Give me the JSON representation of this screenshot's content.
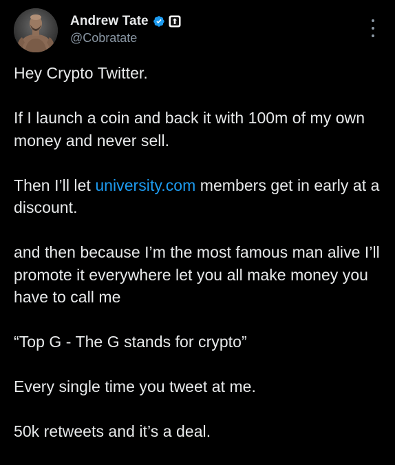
{
  "colors": {
    "background": "#000000",
    "text": "#e7e9ea",
    "secondary_text": "#8b98a5",
    "link": "#1d9bf0",
    "verified_badge": "#1d9bf0"
  },
  "author": {
    "display_name": "Andrew Tate",
    "handle": "@Cobratate",
    "verified_icon": "verified-badge-icon",
    "affiliate_icon": "affiliate-badge-icon"
  },
  "menu": {
    "icon": "more-options-icon"
  },
  "tweet": {
    "p1": "Hey Crypto Twitter.",
    "p2": "If I launch a coin and back it with 100m of my own money and never sell.",
    "p3_before": "Then I’ll let ",
    "p3_link": "university.com",
    "p3_after": " members get in early at a discount.",
    "p4": "and then because I’m the most famous man alive I’ll promote it everywhere let you all make money you have to call me",
    "p5": "“Top G - The G stands for crypto”",
    "p6": "Every single time you tweet at me.",
    "p7": "50k retweets and it’s a deal."
  }
}
